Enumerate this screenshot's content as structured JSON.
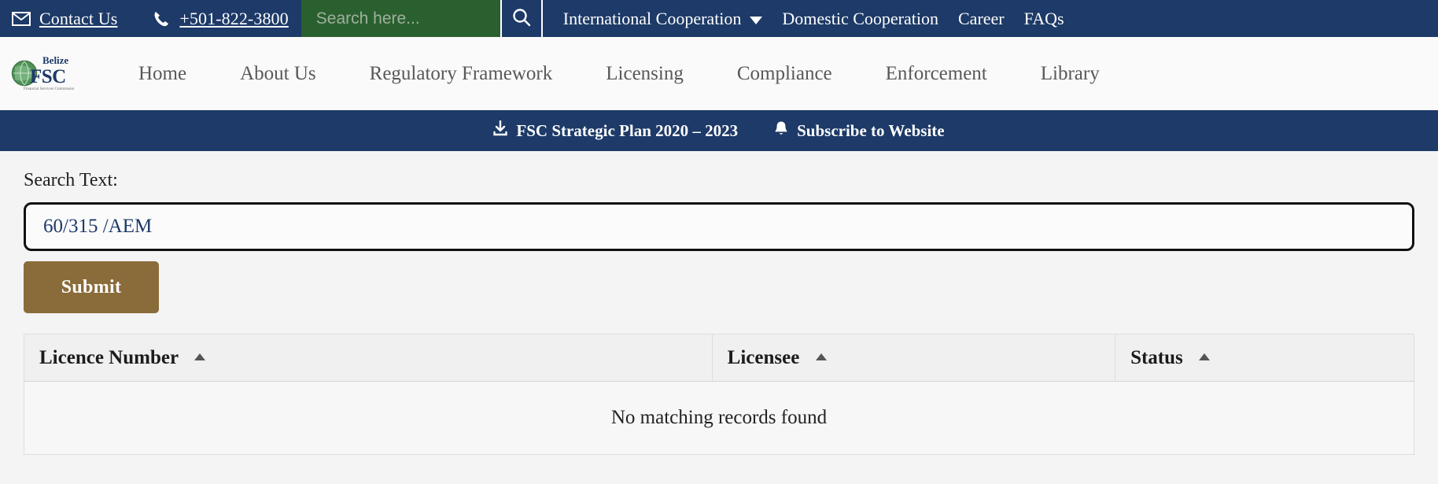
{
  "topbar": {
    "contact_label": "Contact Us",
    "contact_icon": "envelope-icon",
    "phone_label": "+501-822-3800",
    "phone_icon": "phone-icon",
    "search_placeholder": "Search here...",
    "search_value": "",
    "search_button_icon": "search-icon",
    "links": [
      {
        "label": "International Cooperation",
        "has_dropdown": true
      },
      {
        "label": "Domestic Cooperation",
        "has_dropdown": false
      },
      {
        "label": "Career",
        "has_dropdown": false
      },
      {
        "label": "FAQs",
        "has_dropdown": false
      }
    ]
  },
  "brand": {
    "logo_name": "belize-fsc-logo",
    "top_text": "Belize",
    "acronym": "FSC",
    "subtitle": "Financial Services Commission"
  },
  "mainnav": {
    "items": [
      {
        "label": "Home"
      },
      {
        "label": "About Us"
      },
      {
        "label": "Regulatory Framework"
      },
      {
        "label": "Licensing"
      },
      {
        "label": "Compliance"
      },
      {
        "label": "Enforcement"
      },
      {
        "label": "Library"
      }
    ]
  },
  "announce": {
    "items": [
      {
        "label": "FSC Strategic Plan 2020 – 2023",
        "icon": "download-icon"
      },
      {
        "label": "Subscribe to Website",
        "icon": "bell-icon"
      }
    ]
  },
  "form": {
    "label": "Search Text:",
    "input_value": "60/315 /AEM",
    "input_placeholder": "",
    "submit_label": "Submit"
  },
  "table": {
    "columns": [
      {
        "label": "Licence Number",
        "sort": "asc"
      },
      {
        "label": "Licensee",
        "sort": "asc"
      },
      {
        "label": "Status",
        "sort": "asc"
      }
    ],
    "empty_message": "No matching records found",
    "rows": []
  },
  "colors": {
    "navy": "#1d3a68",
    "green": "#2a6030",
    "brown": "#8a6c3b",
    "panel_bg": "#f4f4f4",
    "nav_text": "#585858"
  }
}
